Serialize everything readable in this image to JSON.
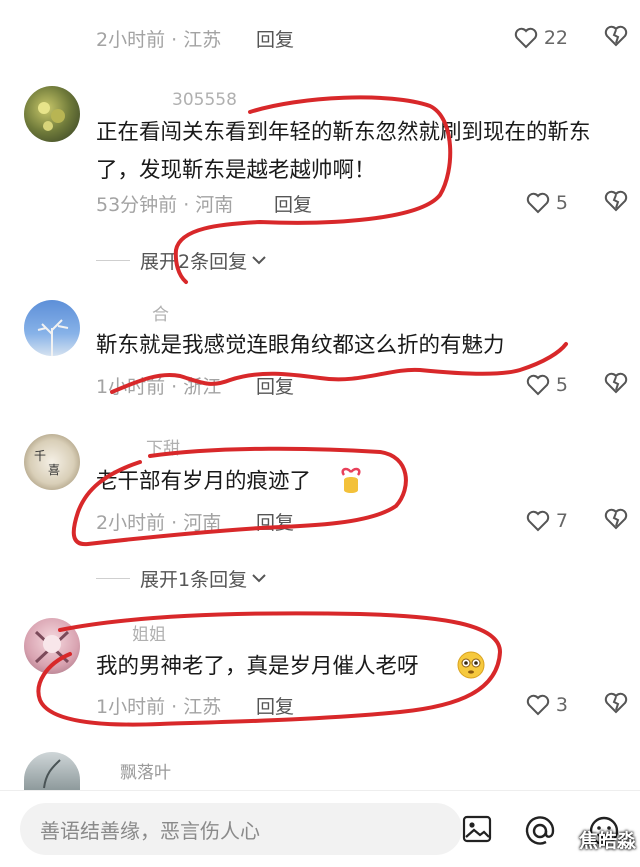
{
  "comments": [
    {
      "username": "",
      "content": "",
      "time": "2小时前 · 江苏",
      "reply_label": "回复",
      "likes": "22"
    },
    {
      "username": "305558",
      "content": "正在看闯关东看到年轻的靳东忽然就刷到现在的靳东了，发现靳东是越老越帅啊！",
      "time": "53分钟前 · 河南",
      "reply_label": "回复",
      "likes": "5",
      "expand_label": "展开2条回复"
    },
    {
      "username": "合",
      "content": "靳东就是我感觉连眼角纹都这么折的有魅力",
      "time": "1小时前 · 浙江",
      "reply_label": "回复",
      "likes": "5"
    },
    {
      "username": "下甜",
      "content": "老干部有岁月的痕迹了",
      "time": "2小时前 · 河南",
      "reply_label": "回复",
      "likes": "7",
      "expand_label": "展开1条回复"
    },
    {
      "username": "姐姐",
      "content": "我的男神老了，真是岁月催人老呀",
      "time": "1小时前 · 江苏",
      "reply_label": "回复",
      "likes": "3"
    },
    {
      "username": "飘落叶",
      "content": "",
      "time": "",
      "reply_label": "",
      "likes": ""
    }
  ],
  "input_bar": {
    "placeholder": "善语结善缘，恶言伤人心"
  },
  "watermark": "焦皓淼",
  "colors": {
    "annotation_red": "#d8282a",
    "meta_grey": "#a3a3a3"
  },
  "icons": [
    "heart-icon",
    "broken-heart-icon",
    "chevron-down-icon",
    "image-icon",
    "at-icon",
    "emoji-icon"
  ]
}
